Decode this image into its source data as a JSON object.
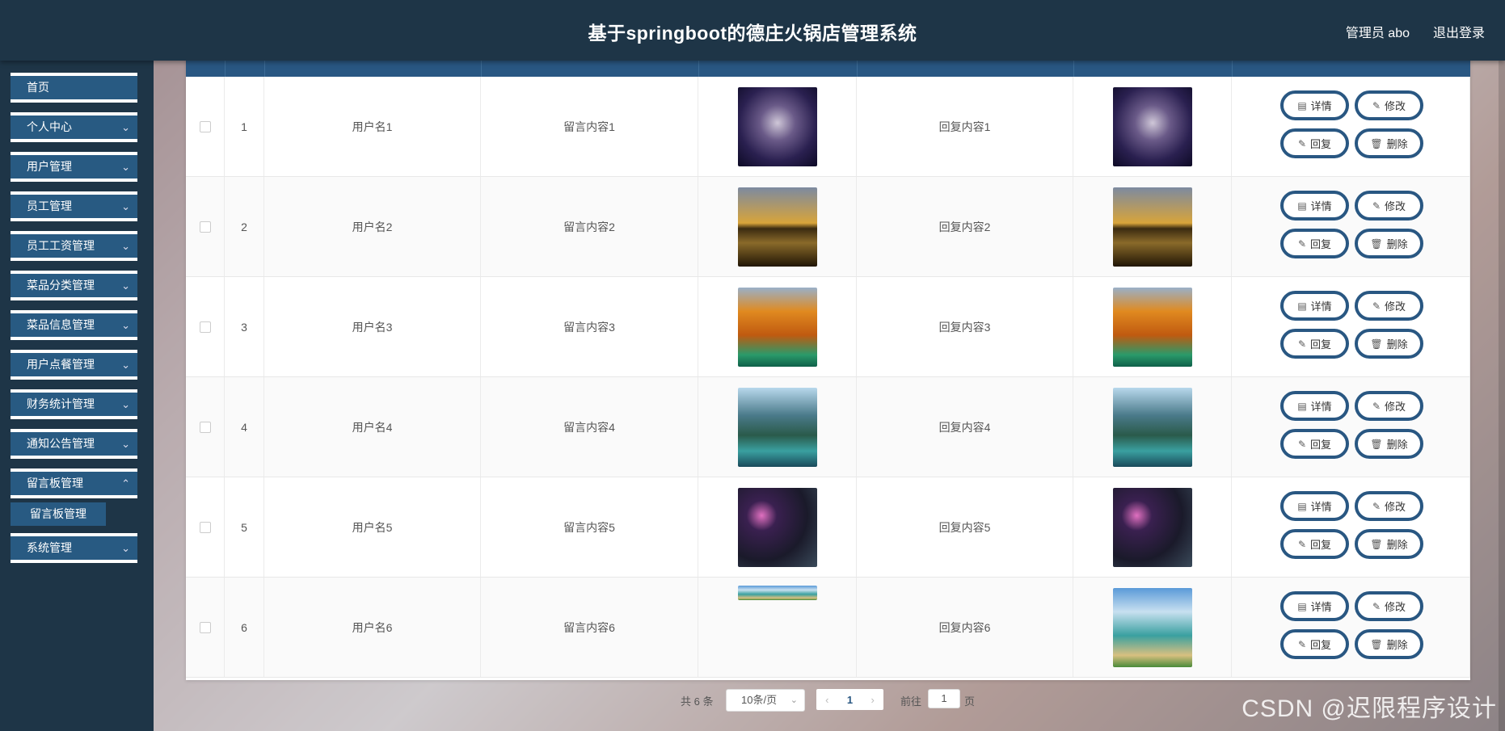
{
  "header": {
    "title": "基于springboot的德庄火锅店管理系统",
    "user_label": "管理员 abo",
    "logout_label": "退出登录"
  },
  "sidebar": {
    "items": [
      {
        "label": "首页",
        "has_arrow": false
      },
      {
        "label": "个人中心",
        "has_arrow": true
      },
      {
        "label": "用户管理",
        "has_arrow": true
      },
      {
        "label": "员工管理",
        "has_arrow": true
      },
      {
        "label": "员工工资管理",
        "has_arrow": true
      },
      {
        "label": "菜品分类管理",
        "has_arrow": true
      },
      {
        "label": "菜品信息管理",
        "has_arrow": true
      },
      {
        "label": "用户点餐管理",
        "has_arrow": true
      },
      {
        "label": "财务统计管理",
        "has_arrow": true
      },
      {
        "label": "通知公告管理",
        "has_arrow": true
      },
      {
        "label": "留言板管理",
        "has_arrow": true
      },
      {
        "label": "系统管理",
        "has_arrow": true
      }
    ],
    "submenu_label": "留言板管理"
  },
  "table": {
    "rows": [
      {
        "index": "1",
        "username": "用户名1",
        "message": "留言内容1",
        "reply": "回复内容1",
        "image": "night-sky-logo"
      },
      {
        "index": "2",
        "username": "用户名2",
        "message": "留言内容2",
        "reply": "回复内容2",
        "image": "tree-sunset-lake"
      },
      {
        "index": "3",
        "username": "用户名3",
        "message": "留言内容3",
        "reply": "回复内容3",
        "image": "autumn-bridge"
      },
      {
        "index": "4",
        "username": "用户名4",
        "message": "留言内容4",
        "reply": "回复内容4",
        "image": "mountain-lake"
      },
      {
        "index": "5",
        "username": "用户名5",
        "message": "留言内容5",
        "reply": "回复内容5",
        "image": "night-moon-garden"
      },
      {
        "index": "6",
        "username": "用户名6",
        "message": "留言内容6",
        "reply": "回复内容6",
        "image": "beach-hut"
      }
    ],
    "actions": {
      "detail": "详情",
      "edit": "修改",
      "reply": "回复",
      "delete": "删除"
    }
  },
  "pagination": {
    "total": "共 6 条",
    "page_size": "10条/页",
    "current_page": "1",
    "goto_label": "前往",
    "goto_value": "1",
    "page_suffix": "页"
  },
  "watermark": "CSDN @迟限程序设计",
  "colors": {
    "header": "#1e3547",
    "accent": "#295782"
  }
}
